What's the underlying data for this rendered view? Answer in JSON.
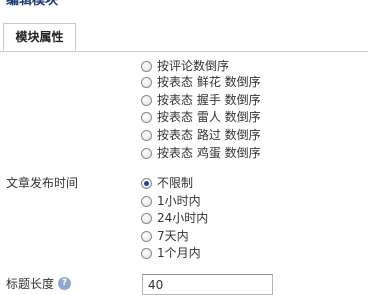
{
  "header": {
    "title": "编辑模块"
  },
  "tabs": [
    {
      "label": "模块属性",
      "active": true
    }
  ],
  "sort_options": [
    {
      "label": "按评论数倒序",
      "checked": false
    },
    {
      "label": "按表态 鲜花 数倒序",
      "checked": false
    },
    {
      "label": "按表态 握手 数倒序",
      "checked": false
    },
    {
      "label": "按表态 雷人 数倒序",
      "checked": false
    },
    {
      "label": "按表态 路过 数倒序",
      "checked": false
    },
    {
      "label": "按表态 鸡蛋 数倒序",
      "checked": false
    }
  ],
  "publish_time": {
    "label": "文章发布时间",
    "options": [
      {
        "label": "不限制",
        "checked": true
      },
      {
        "label": "1小时内",
        "checked": false
      },
      {
        "label": "24小时内",
        "checked": false
      },
      {
        "label": "7天内",
        "checked": false
      },
      {
        "label": "1个月内",
        "checked": false
      }
    ]
  },
  "title_length": {
    "label": "标题长度",
    "help_icon": "question-mark",
    "value": "40"
  },
  "colors": {
    "accent": "#1f4a8a",
    "title": "#1e3c6e",
    "border": "#c9c9c9"
  }
}
